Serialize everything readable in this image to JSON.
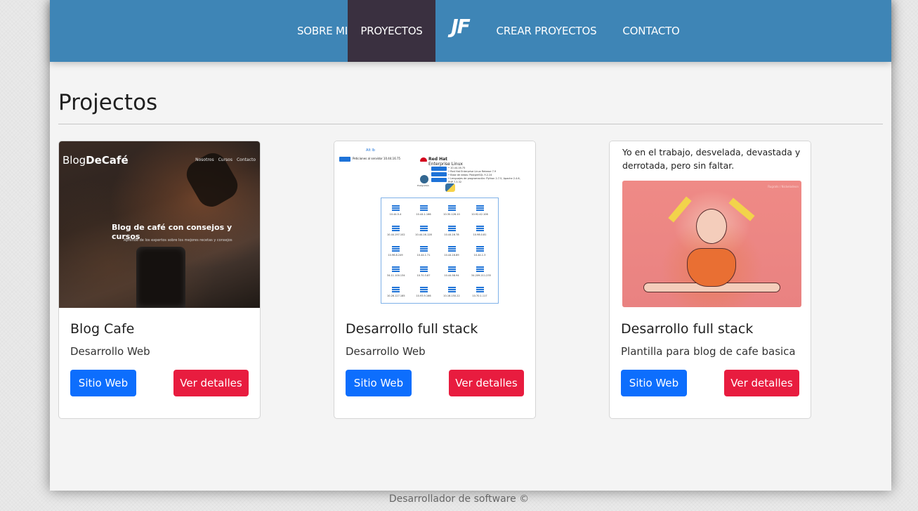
{
  "nav": {
    "items": [
      "SOBRE MI",
      "PROYECTOS",
      "CREAR PROYECTOS",
      "CONTACTO"
    ],
    "active": "PROYECTOS",
    "logo": "JF",
    "color": "#3e85b6",
    "active_color": "#3a3040"
  },
  "page": {
    "title": "Projectos"
  },
  "cards": [
    {
      "title": "Blog Cafe",
      "description": "Desarrollo Web",
      "web_button": "Sitio Web",
      "details_button": "Ver detalles",
      "image": {
        "logo_plain": "Blog",
        "logo_bold": "DeCafé",
        "menu": [
          "Nosotros",
          "Cursos",
          "Contacto"
        ],
        "headline": "Blog de café con consejos y cursos",
        "subline": "Aprende de los expertos sobre los mejores recetas y consejos"
      }
    },
    {
      "title": "Desarrollo full stack",
      "description": "Desarrollo Web",
      "web_button": "Sitio Web",
      "details_button": "Ver detalles",
      "image": {
        "top_label": "Alt lb",
        "request_label": "Peticiones al servidor 10.44.16.75",
        "vendor_line1": "Red Hat",
        "vendor_line2": "Enterprise Linux",
        "details": [
          "• 10.44.16.75",
          "• Red Hat Enterprise Linux Release 7.9",
          "• Base de datos: PostgreSQL 9.2.24",
          "• Lenguajes de programación: Python 2.7.5, Apache 2.4.6,",
          "  PHP 7.3.32"
        ],
        "db_label": "PostgreSQL",
        "nodes": [
          "10.44.5.4",
          "10.44.1.166",
          "10.30.126.10",
          "10.92.42.106",
          "10.44.197.102",
          "10.44.16.128",
          "10.44.16.78",
          "10.98.0.81",
          "10.96.8.249",
          "10.44.1.71",
          "10.44.16.89",
          "10.44.1.3",
          "34.11.100.134",
          "10.70.3.87",
          "10.44.58.94",
          "34.209.211.235",
          "10.26.127.185",
          "10.93.9.166",
          "10.16.150.22",
          "10.70.1.117"
        ]
      }
    },
    {
      "title": "Desarrollo full stack",
      "description": "Plantilla para blog de cafe basica",
      "web_button": "Sitio Web",
      "details_button": "Ver detalles",
      "image": {
        "caption": "Yo en el trabajo, desvelada, devastada y derrotada, pero sin faltar.",
        "watermark": "Rugrats / Nickelodeon"
      }
    }
  ],
  "footer": {
    "text": "Desarrollador de software ©"
  }
}
